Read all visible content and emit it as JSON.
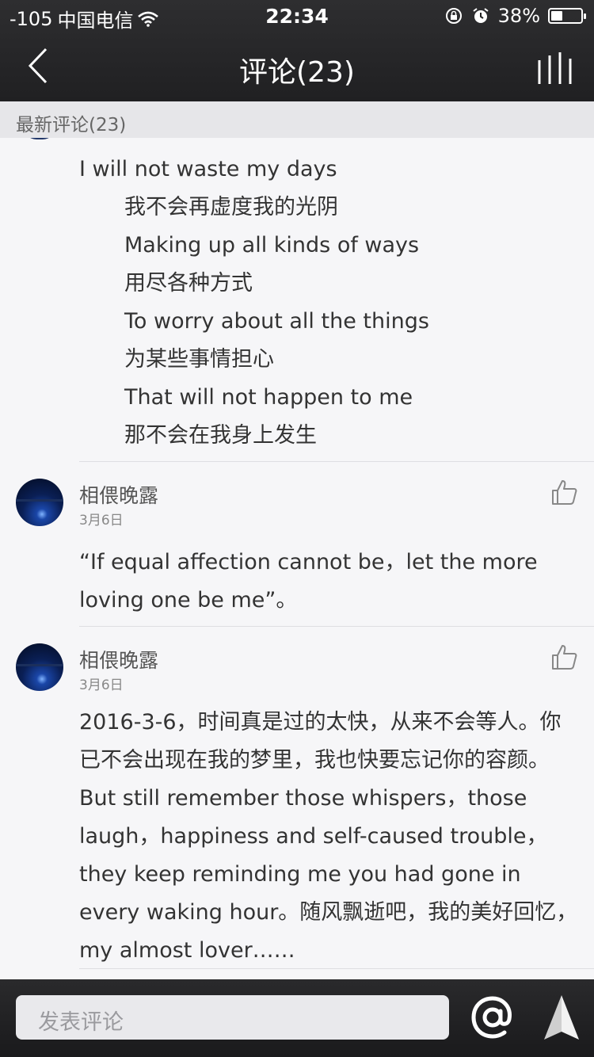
{
  "status": {
    "signal": "-105",
    "carrier": "中国电信",
    "time": "22:34",
    "battery": "38%",
    "battery_level": 0.38
  },
  "nav": {
    "title": "评论(23)"
  },
  "section": {
    "title": "最新评论(23)"
  },
  "lyrics": [
    "I will not waste my days",
    "我不会再虚度我的光阴",
    "Making up all kinds of ways",
    "用尽各种方式",
    "To worry about all the things",
    "为某些事情担心",
    "That will not happen to me",
    "那不会在我身上发生"
  ],
  "comments": [
    {
      "username": "相偎晚露",
      "date": "3月6日",
      "text": "“If equal affection cannot be，let the more loving one be me”。"
    },
    {
      "username": "相偎晚露",
      "date": "3月6日",
      "text": "2016-3-6，时间真是过的太快，从来不会等人。你已不会出现在我的梦里，我也快要忘记你的容颜。But still remember those whispers，those laugh，happiness and self-caused trouble，they keep reminding me you had gone in every waking hour。随风飘逝吧，我的美好回忆，my almost lover……"
    }
  ],
  "composer": {
    "placeholder": "发表评论"
  }
}
